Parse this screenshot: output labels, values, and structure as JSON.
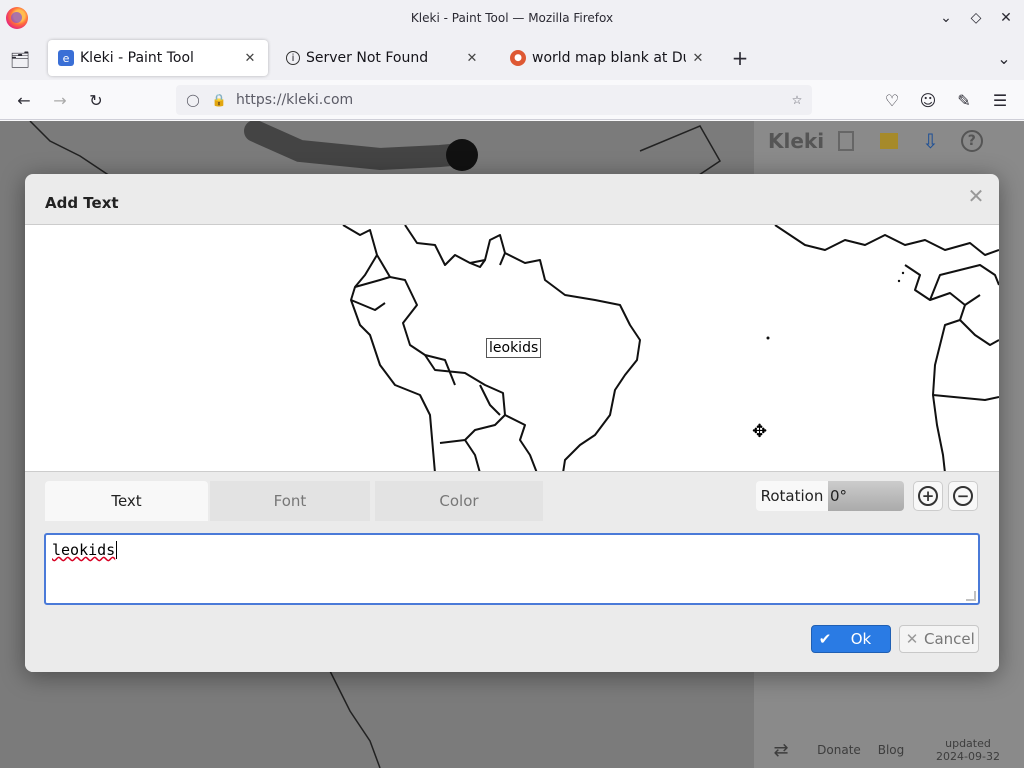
{
  "window": {
    "title": "Kleki - Paint Tool — Mozilla Firefox"
  },
  "tabs": [
    {
      "label": "Kleki - Paint Tool",
      "icon": "kleki-favicon",
      "active": true
    },
    {
      "label": "Server Not Found",
      "icon": "info-icon",
      "active": false
    },
    {
      "label": "world map blank at Duck",
      "icon": "duckduckgo-favicon",
      "active": false
    }
  ],
  "navbar": {
    "url": "https://kleki.com"
  },
  "kleki": {
    "logo": "Kleki",
    "footer": {
      "donate": "Donate",
      "blog": "Blog",
      "updated_label": "updated",
      "updated_date": "2024-09-32"
    }
  },
  "dialog": {
    "title": "Add Text",
    "preview_text": "leokids",
    "tabs": [
      "Text",
      "Font",
      "Color"
    ],
    "rotation_label": "Rotation",
    "rotation_value": "0°",
    "text_value": "leokids",
    "ok_label": "Ok",
    "cancel_label": "Cancel",
    "colors": {
      "ok": "#2a7be4",
      "focus": "#4a7ad8"
    }
  }
}
